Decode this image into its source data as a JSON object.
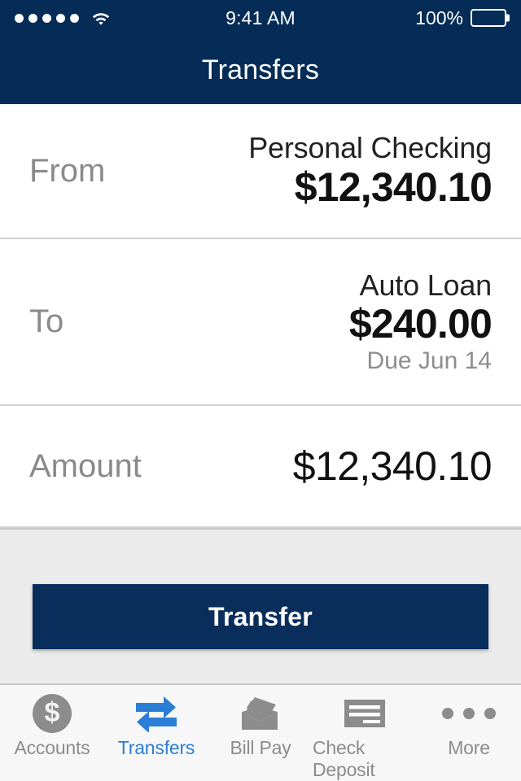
{
  "status_bar": {
    "signal_dots": 5,
    "signal_icon": "signal-dots-icon",
    "wifi_icon": "wifi-icon",
    "time": "9:41 AM",
    "battery_percent": "100%",
    "battery_icon": "battery-full-icon"
  },
  "header": {
    "title": "Transfers",
    "background_color": "#042c56"
  },
  "form": {
    "rows": [
      {
        "label": "From",
        "account": "Personal Checking",
        "amount": "$12,340.10",
        "due": ""
      },
      {
        "label": "To",
        "account": "Auto Loan",
        "amount": "$240.00",
        "due": "Due Jun 14"
      },
      {
        "label": "Amount",
        "account": "",
        "amount": "$12,340.10",
        "due": ""
      }
    ]
  },
  "action": {
    "transfer_label": "Transfer",
    "button_color": "#0a2e5c",
    "panel_color": "#ebebeb"
  },
  "tabbar": {
    "active_color": "#2b7ed6",
    "inactive_color": "#8c8c8c",
    "items": [
      {
        "label": "Accounts",
        "icon": "dollar-circle-icon",
        "active": false
      },
      {
        "label": "Transfers",
        "icon": "transfer-arrows-icon",
        "active": true
      },
      {
        "label": "Bill Pay",
        "icon": "envelope-check-icon",
        "active": false
      },
      {
        "label": "Check Deposit",
        "icon": "check-document-icon",
        "active": false
      },
      {
        "label": "More",
        "icon": "ellipsis-icon",
        "active": false
      }
    ]
  }
}
